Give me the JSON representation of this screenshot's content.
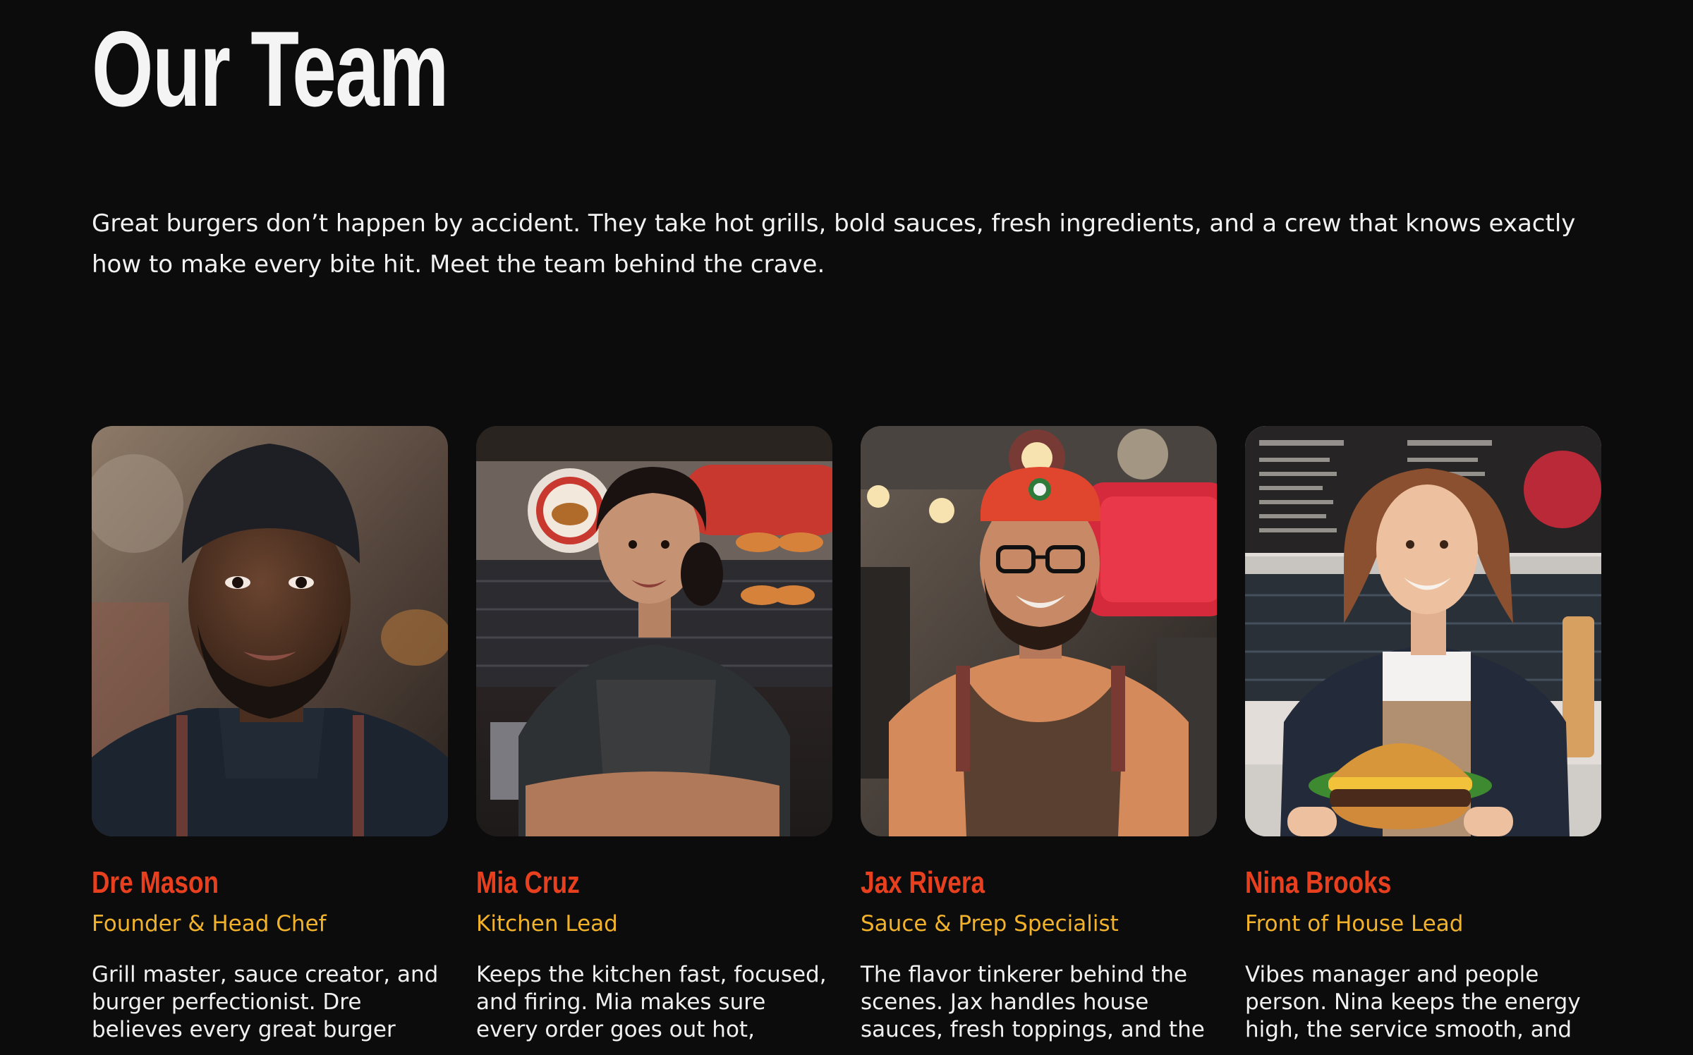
{
  "page": {
    "title": "Our Team",
    "intro": "Great burgers don’t happen by accident. They take hot grills, bold sauces, fresh ingredients, and a crew that knows exactly how to make every bite hit. Meet the team behind the crave."
  },
  "colors": {
    "background": "#0c0c0d",
    "name_accent": "#e8401f",
    "role_accent": "#f2b32a",
    "text": "#f2f2f2"
  },
  "team": [
    {
      "name": "Dre Mason",
      "role": "Founder & Head Chef",
      "bio": "Grill master, sauce creator, and burger perfectionist. Dre believes every great burger"
    },
    {
      "name": "Mia Cruz",
      "role": "Kitchen Lead",
      "bio": "Keeps the kitchen fast, focused, and firing. Mia makes sure every order goes out hot,"
    },
    {
      "name": "Jax Rivera",
      "role": "Sauce & Prep Specialist",
      "bio": "The flavor tinkerer behind the scenes. Jax handles house sauces, fresh toppings, and the"
    },
    {
      "name": "Nina Brooks",
      "role": "Front of House Lead",
      "bio": "Vibes manager and people person. Nina keeps the energy high, the service smooth, and"
    }
  ]
}
